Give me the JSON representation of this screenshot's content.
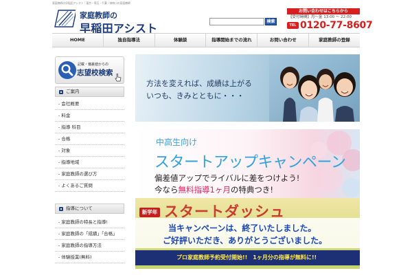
{
  "header": {
    "tagline": "家庭教師の早稲田アシスト｜東京・埼玉・千葉・神奈川の家庭教師",
    "logo_sub": "家庭教師の",
    "logo_main": "早稲田アシスト",
    "search_placeholder": "",
    "search_button": "検索",
    "contact": {
      "head": "お問い合わせはこちらから",
      "hours": "【受付時間】月〜金 13:00 〜 22:00",
      "tel_label": "TEL",
      "phone": "0120-77-8607"
    }
  },
  "nav": {
    "items": [
      "HOME",
      "独自指導法",
      "体験談",
      "指導開始までの流れ",
      "お問い合わせ",
      "家庭教師の登録"
    ]
  },
  "sidebar": {
    "school_search": {
      "sub": "記載・偏差値からの",
      "main": "志望校検索"
    },
    "section1": {
      "title": "ご案内",
      "items": [
        "- 会社概要",
        "- 料金",
        "- 指導 科目",
        "- 合格",
        "- 対象",
        "- 指導地域",
        "- 家庭教師の選び方",
        "- よくあるご質問"
      ]
    },
    "section2": {
      "title": "指導について",
      "items": [
        "- 家庭教師の特長と指導!",
        "- 家庭教師の「成績」「合格」",
        "- 家庭教師の指導方法",
        "- 体験授業(無料)"
      ]
    }
  },
  "banners": {
    "banner1": {
      "line1": "方法を変えれば、成績は上がる",
      "line2": "いつも、きみとともに・・・"
    },
    "banner2": {
      "small": "中高生向け",
      "large": "スタートアップキャンペーン",
      "line1": "偏差値アップでライバルに差をつけよう!",
      "line2_prefix": "今なら",
      "line2_highlight": "無料指導1ヶ月",
      "line2_suffix": "の特典つき!"
    },
    "banner3": {
      "badge": "新学年",
      "title": "スタートダッシュ",
      "ended_line1": "当キャンペーンは、終了いたしました。",
      "ended_line2": "ご好評いただき、ありがとうございました。",
      "strip": "プロ家庭教師予約受付開始!!　1ヶ月分の指導が無料に!!"
    }
  },
  "colors": {
    "brand_blue": "#1a3a7a",
    "accent_red": "#d71f1f",
    "banner_cyan": "#32a2dc",
    "highlight_pink": "#e2245f"
  }
}
